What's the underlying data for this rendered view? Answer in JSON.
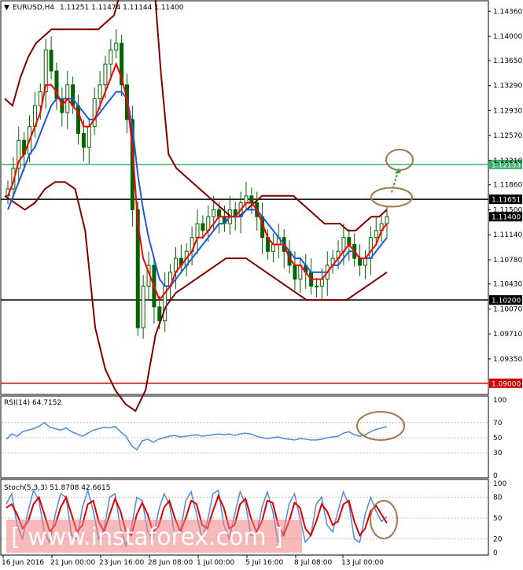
{
  "header": {
    "symbol": "EURUSD,H4",
    "ohlc": "1.11251 1.11474 1.11144 1.11400"
  },
  "watermark": "[  www.instaforex.com  ]",
  "colors": {
    "candle": "#006400",
    "ma_red": "#ff0000",
    "ma_blue": "#1e5bd6",
    "bollinger": "#800000",
    "level_black": "#000000",
    "level_green": "#3cb371",
    "level_red": "#cc0000",
    "rsi": "#4f8bd6",
    "stoch_main": "#4f8bd6",
    "stoch_signal": "#e00000",
    "ellipse": "#a0784a",
    "arrow": "#22aa22"
  },
  "chart_data": [
    {
      "type": "candlestick",
      "title": "EURUSD,H4",
      "ylim": [
        1.0885,
        1.145
      ],
      "price_ticks": [
        "1.14360",
        "1.14000",
        "1.13650",
        "1.13290",
        "1.12930",
        "1.12570",
        "1.12210",
        "1.11860",
        "1.11500",
        "1.11140",
        "1.10780",
        "1.10430",
        "1.10070",
        "1.09710",
        "1.09350"
      ],
      "levels": [
        {
          "value": 1.12153,
          "label": "1.12153",
          "color": "level_green"
        },
        {
          "value": 1.11651,
          "label": "1.11651",
          "color": "level_black"
        },
        {
          "value": 1.102,
          "label": "1.10200",
          "color": "level_black"
        },
        {
          "value": 1.09,
          "label": "1.09000",
          "color": "level_red"
        }
      ],
      "current_price": {
        "value": 1.114,
        "label": "1.11400"
      },
      "x_labels": [
        "16 Jun 2016",
        "21 Jun 00:00",
        "23 Jun 16:00",
        "28 Jun 08:00",
        "1 Jul 00:00",
        "5 Jul 16:00",
        "8 Jul 08:00",
        "13 Jul 00:00"
      ],
      "closes": [
        1.118,
        1.121,
        1.125,
        1.123,
        1.127,
        1.13,
        1.132,
        1.138,
        1.135,
        1.131,
        1.129,
        1.133,
        1.13,
        1.126,
        1.124,
        1.127,
        1.131,
        1.133,
        1.136,
        1.138,
        1.139,
        1.133,
        1.128,
        1.115,
        1.098,
        1.104,
        1.107,
        1.101,
        1.099,
        1.104,
        1.106,
        1.108,
        1.107,
        1.109,
        1.111,
        1.113,
        1.112,
        1.114,
        1.115,
        1.114,
        1.113,
        1.115,
        1.114,
        1.116,
        1.117,
        1.116,
        1.114,
        1.111,
        1.109,
        1.11,
        1.111,
        1.109,
        1.107,
        1.105,
        1.107,
        1.106,
        1.104,
        1.104,
        1.105,
        1.107,
        1.108,
        1.109,
        1.111,
        1.11,
        1.108,
        1.107,
        1.108,
        1.111,
        1.112,
        1.113,
        1.114
      ],
      "red_ma": [
        1.117,
        1.119,
        1.122,
        1.123,
        1.125,
        1.127,
        1.129,
        1.133,
        1.133,
        1.132,
        1.13,
        1.131,
        1.13,
        1.129,
        1.127,
        1.127,
        1.128,
        1.13,
        1.132,
        1.134,
        1.136,
        1.134,
        1.131,
        1.124,
        1.113,
        1.108,
        1.106,
        1.104,
        1.102,
        1.103,
        1.104,
        1.106,
        1.107,
        1.108,
        1.109,
        1.111,
        1.111,
        1.112,
        1.113,
        1.114,
        1.114,
        1.114,
        1.114,
        1.115,
        1.116,
        1.116,
        1.115,
        1.113,
        1.111,
        1.11,
        1.11,
        1.11,
        1.108,
        1.107,
        1.107,
        1.106,
        1.105,
        1.105,
        1.105,
        1.106,
        1.107,
        1.108,
        1.109,
        1.11,
        1.109,
        1.108,
        1.108,
        1.109,
        1.11,
        1.112,
        1.113
      ],
      "blue_ma": [
        1.115,
        1.117,
        1.119,
        1.121,
        1.123,
        1.124,
        1.126,
        1.128,
        1.13,
        1.131,
        1.131,
        1.131,
        1.131,
        1.13,
        1.129,
        1.128,
        1.128,
        1.129,
        1.13,
        1.131,
        1.132,
        1.132,
        1.131,
        1.127,
        1.12,
        1.115,
        1.111,
        1.108,
        1.105,
        1.104,
        1.104,
        1.105,
        1.106,
        1.107,
        1.108,
        1.109,
        1.11,
        1.111,
        1.112,
        1.113,
        1.113,
        1.114,
        1.114,
        1.114,
        1.115,
        1.115,
        1.115,
        1.114,
        1.113,
        1.112,
        1.111,
        1.11,
        1.109,
        1.108,
        1.108,
        1.107,
        1.106,
        1.106,
        1.106,
        1.106,
        1.107,
        1.107,
        1.108,
        1.109,
        1.109,
        1.108,
        1.108,
        1.108,
        1.109,
        1.11,
        1.111
      ],
      "boll_upper": [
        1.131,
        1.13,
        1.134,
        1.137,
        1.139,
        1.14,
        1.141,
        1.141,
        1.141,
        1.141,
        1.141,
        1.141,
        1.141,
        1.142,
        1.143,
        1.147,
        1.155,
        1.16,
        1.16,
        1.15,
        1.135,
        1.123,
        1.121,
        1.12,
        1.119,
        1.118,
        1.117,
        1.116,
        1.115,
        1.114,
        1.114,
        1.115,
        1.116,
        1.117,
        1.117,
        1.117,
        1.117,
        1.117,
        1.116,
        1.115,
        1.114,
        1.113,
        1.113,
        1.113,
        1.112,
        1.112,
        1.113,
        1.114,
        1.114,
        1.115
      ],
      "boll_lower": [
        1.117,
        1.116,
        1.115,
        1.116,
        1.118,
        1.119,
        1.119,
        1.118,
        1.112,
        1.098,
        1.092,
        1.089,
        1.087,
        1.086,
        1.089,
        1.097,
        1.101,
        1.103,
        1.104,
        1.105,
        1.106,
        1.107,
        1.108,
        1.108,
        1.108,
        1.107,
        1.106,
        1.105,
        1.104,
        1.103,
        1.102,
        1.102,
        1.102,
        1.102,
        1.102,
        1.103,
        1.104,
        1.105,
        1.106
      ],
      "arrow": {
        "from": 1.1175,
        "to": 1.121
      }
    },
    {
      "type": "line",
      "title": "RSI(14) 64.7152",
      "ylim": [
        0,
        100
      ],
      "ticks": [
        "100",
        "70",
        "50",
        "30",
        "0"
      ],
      "levels": [
        70,
        50,
        30
      ],
      "values": [
        48,
        55,
        52,
        58,
        60,
        62,
        65,
        70,
        64,
        62,
        60,
        63,
        58,
        55,
        52,
        56,
        60,
        62,
        64,
        63,
        65,
        58,
        52,
        40,
        34,
        46,
        48,
        44,
        48,
        50,
        52,
        53,
        51,
        52,
        53,
        54,
        52,
        53,
        54,
        55,
        54,
        55,
        53,
        55,
        56,
        55,
        52,
        50,
        49,
        50,
        51,
        49,
        48,
        47,
        49,
        48,
        47,
        47,
        48,
        50,
        51,
        52,
        56,
        58,
        54,
        52,
        54,
        58,
        61,
        63,
        64.7
      ]
    },
    {
      "type": "line",
      "title": "Stoch(5,3,3) 51.8708 42.6615",
      "ylim": [
        0,
        100
      ],
      "ticks": [
        "100",
        "80",
        "50",
        "20",
        "0"
      ],
      "levels": [
        80,
        50,
        20
      ],
      "main": [
        70,
        85,
        40,
        20,
        60,
        90,
        75,
        30,
        15,
        55,
        85,
        80,
        25,
        20,
        65,
        90,
        60,
        20,
        35,
        80,
        85,
        35,
        10,
        35,
        80,
        75,
        30,
        20,
        60,
        85,
        70,
        25,
        30,
        75,
        88,
        55,
        20,
        45,
        85,
        90,
        40,
        20,
        55,
        88,
        70,
        25,
        25,
        65,
        88,
        60,
        15,
        30,
        70,
        85,
        50,
        15,
        25,
        70,
        80,
        40,
        30,
        60,
        88,
        70,
        20,
        15,
        55,
        80,
        60,
        45,
        51.9
      ],
      "signal": [
        65,
        70,
        55,
        35,
        45,
        70,
        80,
        55,
        30,
        40,
        65,
        80,
        55,
        30,
        40,
        70,
        75,
        45,
        30,
        55,
        78,
        60,
        30,
        25,
        55,
        72,
        55,
        30,
        38,
        65,
        75,
        50,
        30,
        50,
        75,
        70,
        40,
        35,
        60,
        82,
        65,
        35,
        40,
        70,
        78,
        50,
        30,
        45,
        75,
        72,
        40,
        25,
        45,
        72,
        65,
        35,
        25,
        45,
        70,
        60,
        40,
        45,
        70,
        75,
        45,
        25,
        35,
        60,
        68,
        55,
        42.7
      ]
    }
  ]
}
